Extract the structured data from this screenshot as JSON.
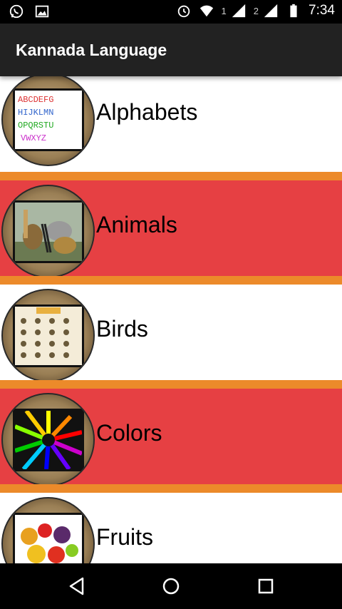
{
  "status_bar": {
    "time": "7:34",
    "sim1_label": "1",
    "sim2_label": "2",
    "icons": [
      "whatsapp-icon",
      "image-icon",
      "alarm-icon",
      "wifi-icon",
      "signal-icon",
      "battery-icon"
    ]
  },
  "app_bar": {
    "title": "Kannada Language"
  },
  "categories": [
    {
      "label": "Alphabets",
      "thumbnail": "alphabet-chart-image",
      "row_color": "#ffffff"
    },
    {
      "label": "Animals",
      "thumbnail": "animals-image",
      "row_color": "#e64043"
    },
    {
      "label": "Birds",
      "thumbnail": "birds-chart-image",
      "row_color": "#ffffff"
    },
    {
      "label": "Colors",
      "thumbnail": "color-pencils-image",
      "row_color": "#e64043"
    },
    {
      "label": "Fruits",
      "thumbnail": "fruits-image",
      "row_color": "#ffffff"
    }
  ],
  "colors": {
    "separator": "#ec8a2a",
    "highlight_row": "#e64043",
    "app_bar": "#222222"
  },
  "nav_bar": {
    "icons": [
      "back-icon",
      "home-icon",
      "recents-icon"
    ]
  }
}
